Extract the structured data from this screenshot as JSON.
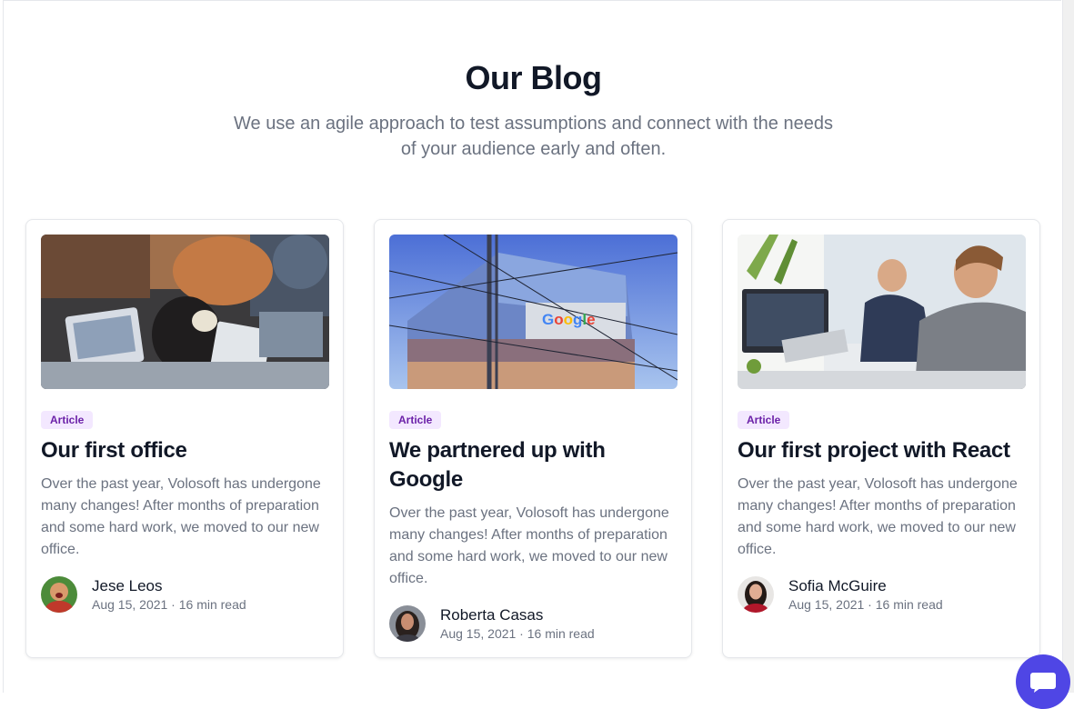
{
  "section": {
    "title": "Our Blog",
    "subtitle": "We use an agile approach to test assumptions and connect with the needs of your audience early and often."
  },
  "posts": [
    {
      "badge": "Article",
      "title": "Our first office",
      "excerpt": "Over the past year, Volosoft has undergone many changes! After months of preparation and some hard work, we moved to our new office.",
      "author": "Jese Leos",
      "meta": "Aug 15, 2021 · 16 min read",
      "image_icon": "office-team-photo",
      "avatar_icon": "avatar-photo"
    },
    {
      "badge": "Article",
      "title": "We partnered up with Google",
      "excerpt": "Over the past year, Volosoft has undergone many changes! After months of preparation and some hard work, we moved to our new office.",
      "author": "Roberta Casas",
      "meta": "Aug 15, 2021 · 16 min read",
      "image_icon": "google-building-photo",
      "avatar_icon": "avatar-photo"
    },
    {
      "badge": "Article",
      "title": "Our first project with React",
      "excerpt": "Over the past year, Volosoft has undergone many changes! After months of preparation and some hard work, we moved to our new office.",
      "author": "Sofia McGuire",
      "meta": "Aug 15, 2021 · 16 min read",
      "image_icon": "developers-photo",
      "avatar_icon": "avatar-photo"
    }
  ],
  "chat": {
    "icon": "chat-icon"
  },
  "colors": {
    "badge_text": "#6b21a8",
    "badge_bg": "#f3e8ff",
    "accent": "#4f46e5",
    "muted_text": "#6b7280"
  }
}
